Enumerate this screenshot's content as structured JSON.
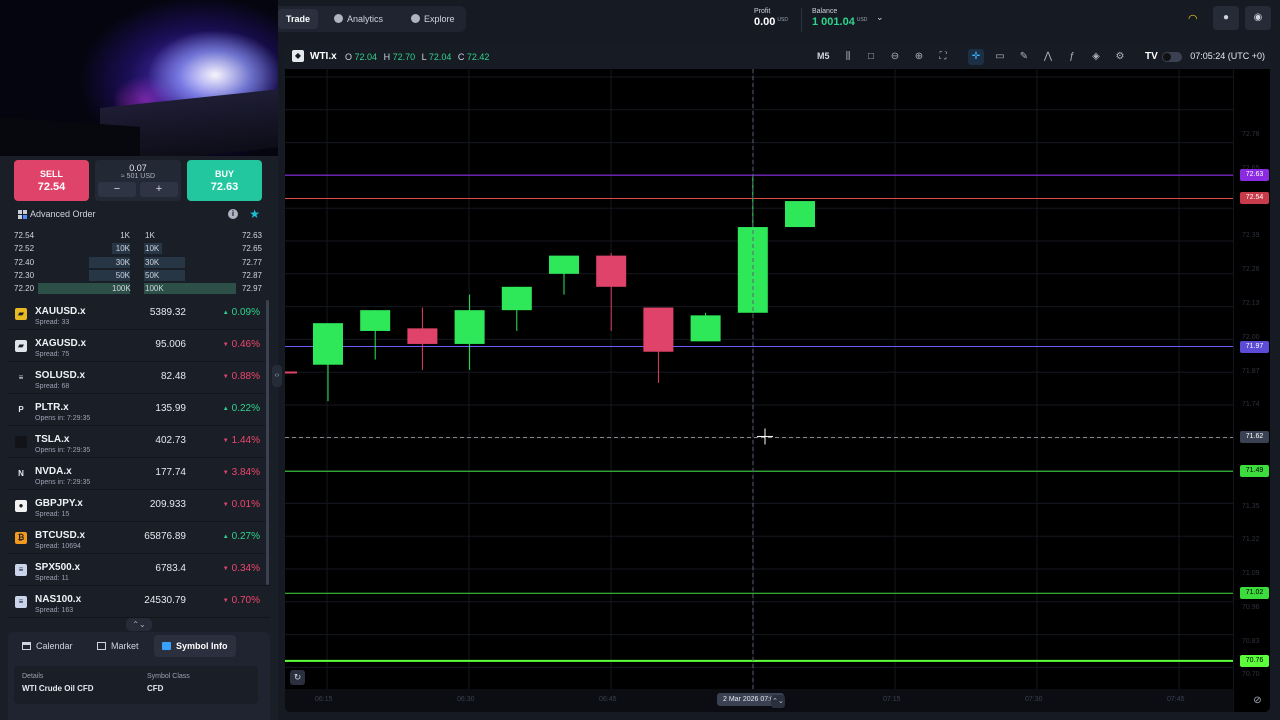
{
  "nav": {
    "trade": "Trade",
    "analytics": "Analytics",
    "explore": "Explore"
  },
  "account": {
    "profit_label": "Profit",
    "profit_value": "0.00",
    "profit_ccy": "USD",
    "balance_label": "Balance",
    "balance_value": "1 001.04",
    "balance_ccy": "USD"
  },
  "order": {
    "sell_label": "SELL",
    "sell_price": "72.54",
    "buy_label": "BUY",
    "buy_price": "72.63",
    "quantity": "0.07",
    "quantity_usd": "≈ 501 USD",
    "minus": "−",
    "plus": "+",
    "advanced_label": "Advanced Order"
  },
  "depth": [
    {
      "bid": "72.54",
      "bid_vol": "1K",
      "ask_vol": "1K",
      "ask": "72.63",
      "fill": 0.0
    },
    {
      "bid": "72.52",
      "bid_vol": "10K",
      "ask_vol": "10K",
      "ask": "72.65",
      "fill": 0.2
    },
    {
      "bid": "72.40",
      "bid_vol": "30K",
      "ask_vol": "30K",
      "ask": "72.77",
      "fill": 0.45
    },
    {
      "bid": "72.30",
      "bid_vol": "50K",
      "ask_vol": "50K",
      "ask": "72.87",
      "fill": 0.45
    },
    {
      "bid": "72.20",
      "bid_vol": "100K",
      "ask_vol": "100K",
      "ask": "72.97",
      "fill": 1.0
    }
  ],
  "watchlist": [
    {
      "symbol": "XAUUSD.x",
      "sub": "Spread: 33",
      "price": "5389.32",
      "change": "0.09%",
      "dir": "up",
      "icon": "gold-icon",
      "icon_char": "▰",
      "icon_color": "#e8b923"
    },
    {
      "symbol": "XAGUSD.x",
      "sub": "Spread: 75",
      "price": "95.006",
      "change": "0.46%",
      "dir": "down",
      "icon": "silver-icon",
      "icon_char": "▰",
      "icon_color": "#dfe3ea"
    },
    {
      "symbol": "SOLUSD.x",
      "sub": "Spread: 68",
      "price": "82.48",
      "change": "0.88%",
      "dir": "down",
      "icon": "solana-icon",
      "icon_char": "≡",
      "icon_color": "#1a1e27"
    },
    {
      "symbol": "PLTR.x",
      "sub": "Opens in: 7:29:35",
      "price": "135.99",
      "change": "0.22%",
      "dir": "up",
      "icon": "palantir-icon",
      "icon_char": "P",
      "icon_color": "#1a1e27"
    },
    {
      "symbol": "TSLA.x",
      "sub": "Opens in: 7:29:35",
      "price": "402.73",
      "change": "1.44%",
      "dir": "down",
      "icon": "tesla-icon",
      "icon_char": "",
      "icon_color": "#111318"
    },
    {
      "symbol": "NVDA.x",
      "sub": "Opens in: 7:29:35",
      "price": "177.74",
      "change": "3.84%",
      "dir": "down",
      "icon": "nvidia-icon",
      "icon_char": "N",
      "icon_color": "#1a1e27"
    },
    {
      "symbol": "GBPJPY.x",
      "sub": "Spread: 15",
      "price": "209.933",
      "change": "0.01%",
      "dir": "down",
      "icon": "gbp-jpy-flag-icon",
      "icon_char": "●",
      "icon_color": "#f2f2f2"
    },
    {
      "symbol": "BTCUSD.x",
      "sub": "Spread: 10694",
      "price": "65876.89",
      "change": "0.27%",
      "dir": "up",
      "icon": "bitcoin-icon",
      "icon_char": "₿",
      "icon_color": "#f39a1e"
    },
    {
      "symbol": "SPX500.x",
      "sub": "Spread: 11",
      "price": "6783.4",
      "change": "0.34%",
      "dir": "down",
      "icon": "us-flag-icon",
      "icon_char": "≡",
      "icon_color": "#c9d3ea"
    },
    {
      "symbol": "NAS100.x",
      "sub": "Spread: 163",
      "price": "24530.79",
      "change": "0.70%",
      "dir": "down",
      "icon": "us-flag-icon",
      "icon_char": "≡",
      "icon_color": "#c9d3ea"
    }
  ],
  "bottom_tabs": {
    "calendar": "Calendar",
    "market": "Market",
    "symbol_info": "Symbol Info"
  },
  "details": {
    "details_label": "Details",
    "details_value": "WTI Crude Oil CFD",
    "class_label": "Symbol Class",
    "class_value": "CFD"
  },
  "chart_header": {
    "symbol": "WTI.x",
    "o_label": "O",
    "o": "72.04",
    "h_label": "H",
    "h": "72.70",
    "l_label": "L",
    "l": "72.04",
    "c_label": "C",
    "c": "72.42",
    "timeframe": "M5",
    "time": "07:05:24 (UTC +0)",
    "tv_logo": "TV"
  },
  "chart_data": {
    "type": "candlestick",
    "x_labels": [
      "06:15",
      "06:30",
      "06:45",
      "2 Mar 2026 07:00",
      "07:15",
      "07:30",
      "07:45"
    ],
    "y_range": [
      70.64,
      73.0
    ],
    "candles": [
      {
        "o": 71.9,
        "h": 72.03,
        "l": 71.76,
        "c": 72.06
      },
      {
        "o": 72.03,
        "h": 72.11,
        "l": 71.92,
        "c": 72.11
      },
      {
        "o": 72.04,
        "h": 72.12,
        "l": 71.88,
        "c": 71.98
      },
      {
        "o": 71.98,
        "h": 72.17,
        "l": 71.88,
        "c": 72.11
      },
      {
        "o": 72.11,
        "h": 72.2,
        "l": 72.03,
        "c": 72.2
      },
      {
        "o": 72.25,
        "h": 72.31,
        "l": 72.17,
        "c": 72.32
      },
      {
        "o": 72.32,
        "h": 72.33,
        "l": 72.03,
        "c": 72.2
      },
      {
        "o": 72.12,
        "h": 72.12,
        "l": 71.83,
        "c": 71.95
      },
      {
        "o": 71.99,
        "h": 72.1,
        "l": 71.99,
        "c": 72.09
      },
      {
        "o": 72.1,
        "h": 72.63,
        "l": 72.1,
        "c": 72.43
      },
      {
        "o": 72.43,
        "h": 72.5,
        "l": 72.43,
        "c": 72.53
      }
    ],
    "price_lines": [
      {
        "value": "72.63",
        "color": "#9b30ff",
        "label_bg": "#8a2be2"
      },
      {
        "value": "72.54",
        "color": "#e04a4a",
        "label_bg": "#c83b4b"
      },
      {
        "value": "71.97",
        "color": "#6b5cff",
        "label_bg": "#5b4bd6"
      },
      {
        "value": "71.62",
        "color": "#888888",
        "label_bg": "#3a4152",
        "dashed": true
      },
      {
        "value": "71.49",
        "color": "#3ddc3d",
        "label_bg": "#3ddc3d"
      },
      {
        "value": "71.02",
        "color": "#3ddc3d",
        "label_bg": "#3ddc3d"
      },
      {
        "value": "70.76",
        "color": "#5cff3b",
        "label_bg": "#5cff3b"
      }
    ],
    "colors": {
      "up": "#2ee85a",
      "down": "#e0436a"
    }
  }
}
